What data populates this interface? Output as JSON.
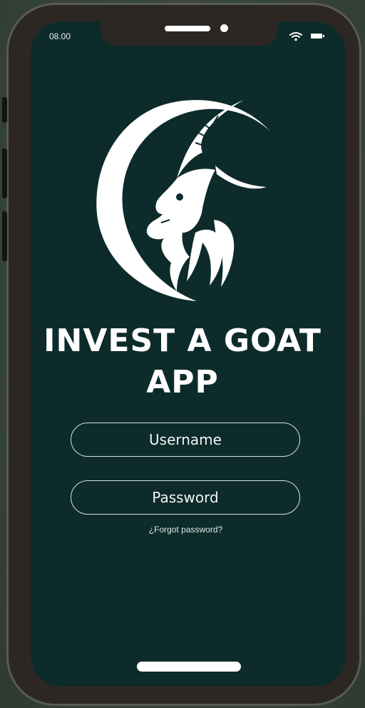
{
  "status_bar": {
    "time": "08.00",
    "wifi_icon": "wifi-icon",
    "battery_icon": "battery-icon"
  },
  "logo": {
    "icon": "goat-head-logo"
  },
  "app": {
    "title_line1": "INVEST A GOAT",
    "title_line2": "APP"
  },
  "login": {
    "username_placeholder": "Username",
    "username_value": "",
    "password_placeholder": "Password",
    "password_value": "",
    "forgot_password": "¿Forgot password?"
  },
  "colors": {
    "screen_background": "#0d2b2b",
    "phone_frame": "#2d2724",
    "text": "#ffffff"
  }
}
